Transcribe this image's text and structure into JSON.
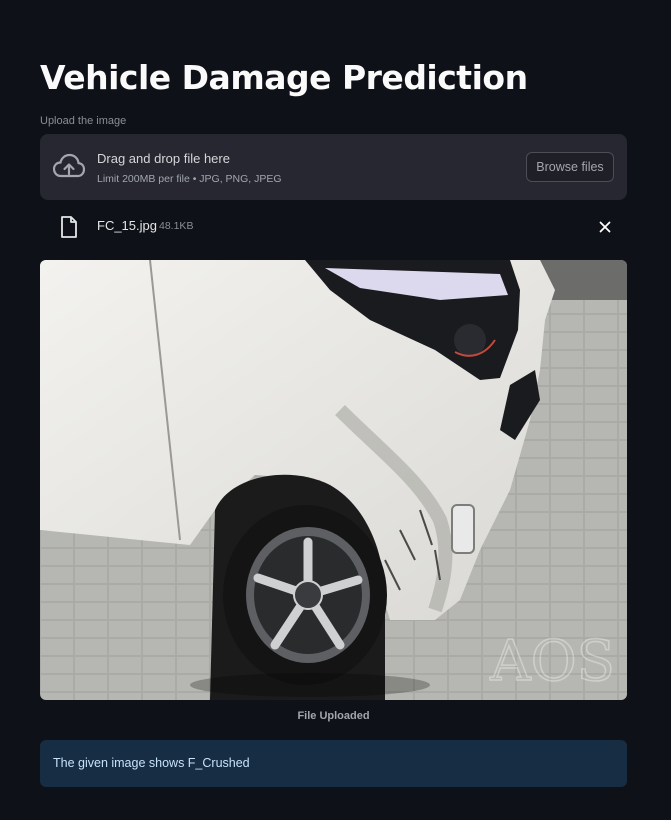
{
  "page": {
    "title": "Vehicle Damage Prediction"
  },
  "uploader": {
    "label": "Upload the image",
    "drop_text": "Drag and drop file here",
    "limit_text": "Limit 200MB per file • JPG, PNG, JPEG",
    "browse_label": "Browse files",
    "icon": "cloud-upload-icon"
  },
  "file": {
    "name": "FC_15.jpg",
    "size": "48.1KB",
    "icon": "file-icon"
  },
  "image": {
    "watermark": "AOS",
    "caption": "File Uploaded"
  },
  "result": {
    "text": "The given image shows F_Crushed"
  },
  "colors": {
    "background": "#0e1117",
    "dropzone": "#262730",
    "info_box": "#172d43",
    "info_text": "#c7e2fb"
  }
}
